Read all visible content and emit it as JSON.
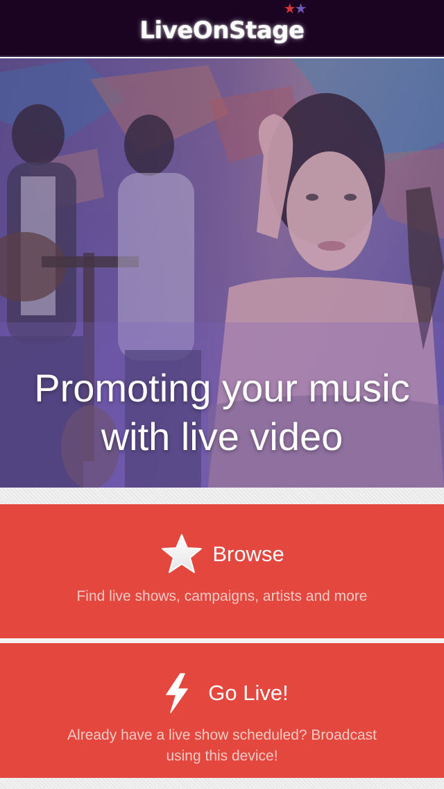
{
  "header": {
    "logo_text": "LiveOnStage",
    "logo_star_left": "★",
    "logo_star_right": "★"
  },
  "hero": {
    "headline": "Promoting your music with live video"
  },
  "actions": [
    {
      "title": "Browse",
      "description": "Find live shows, campaigns, artists and more",
      "icon": "star-icon"
    },
    {
      "title": "Go Live!",
      "description": "Already have a live show scheduled? Broadcast using this device!",
      "icon": "lightning-bolt-icon"
    }
  ],
  "colors": {
    "header_bg": "#1a0422",
    "card_bg": "#e3473d",
    "card_desc_text": "#f1c9c5",
    "logo_star_red": "#d8323a",
    "logo_star_purple": "#6d5ab8"
  }
}
